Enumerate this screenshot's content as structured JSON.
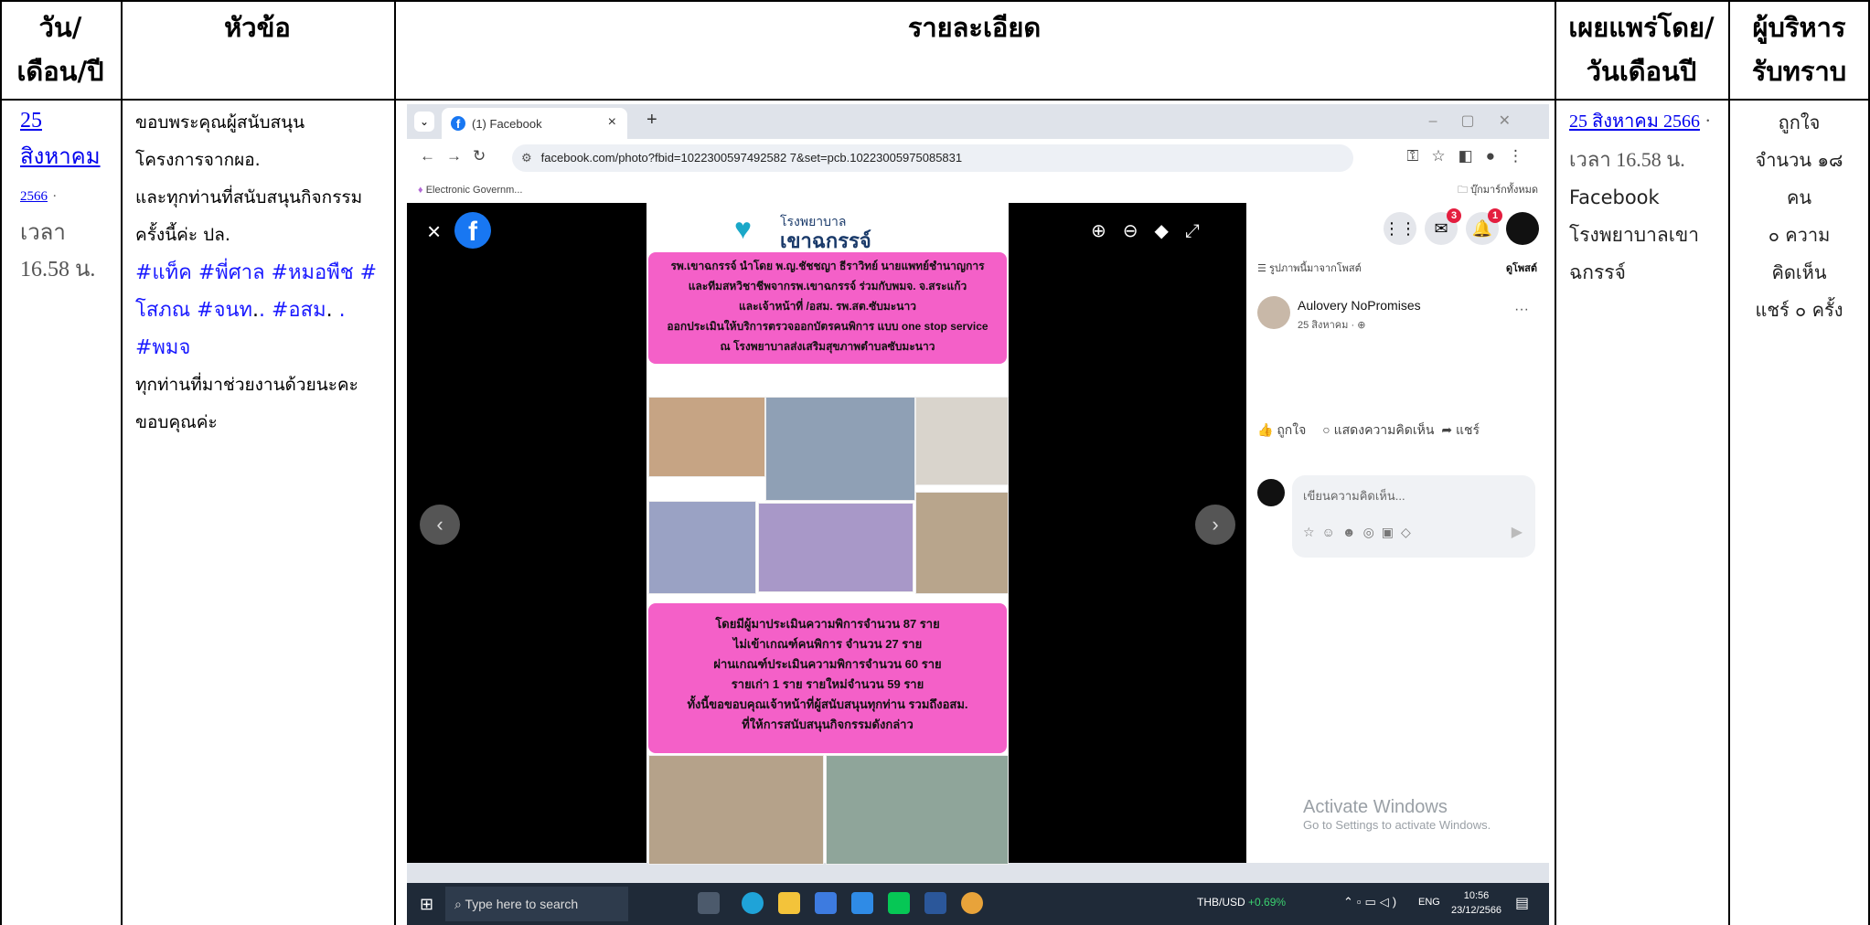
{
  "headers": {
    "date": [
      "วัน/",
      "เดือน/ปี"
    ],
    "topic": "หัวข้อ",
    "details": "รายละเอียด",
    "published": [
      "เผยแพร่โดย/",
      "วันเดือนปี"
    ],
    "admin": [
      "ผู้บริหาร",
      "รับทราบ"
    ]
  },
  "row": {
    "date_link_1": "25 สิงหาคม",
    "date_link_2": "2566",
    "date_dot": "·",
    "time_1": "เวลา",
    "time_2": "16.58 น.",
    "topic_lines": [
      "ขอบพระคุณผู้สนับสนุน",
      "โครงการจากผอ.",
      "และทุกท่านที่สนับสนุนกิจกรรม",
      "ครั้งนี้ค่ะ ปล."
    ],
    "hashtag_line_1": "#แท็ค #พี่ศาล #หมอพืช #",
    "hashtag_line_2_a": "โสภณ #จนท",
    "hashtag_line_2_b": ". #อสม",
    "hashtag_line_2_c": ". #พมจ",
    "hashtag_line_2_d": ".",
    "topic_tail": [
      "ทุกท่านที่มาช่วยงานด้วยนะคะ",
      "ขอบคุณค่ะ"
    ],
    "pub_link": "25 สิงหาคม 2566",
    "pub_dot": "·",
    "pub_time": "เวลา 16.58 น.",
    "pub_source": [
      "Facebook",
      "โรงพยาบาลเขา",
      "ฉกรรจ์"
    ],
    "admin_lines": [
      "ถูกใจ",
      "จำนวน ๑๘",
      "คน",
      "๐ ความ",
      "คิดเห็น",
      "แชร์ ๐ ครั้ง"
    ]
  },
  "screenshot": {
    "tab_title": "(1) Facebook",
    "url": "facebook.com/photo?fbid=1022300597492582 7&set=pcb.10223005975085831",
    "bookmark": "Electronic Governm...",
    "bookmark_folder": "บุ๊กมาร์กทั้งหมด",
    "hospital_small": "โรงพยาบาล",
    "hospital_big": "เขาฉกรรจ์",
    "poster_top": [
      "รพ.เขาฉกรรจ์ นำโดย พ.ญ.ชัชชญา ธีราวิทย์ นายแพทย์ชำนาญการ",
      "และทีมสหวิชาชีพจากรพ.เขาฉกรรจ์ ร่วมกับพมจ. จ.สระแก้ว",
      "และเจ้าหน้าที่ /อสม. รพ.สต.ซับมะนาว",
      "ออกประเมินให้บริการตรวจออกบัตรคนพิการ แบบ one stop service",
      "ณ โรงพยาบาลส่งเสริมสุขภาพตำบลซับมะนาว"
    ],
    "poster_bottom": [
      "โดยมีผู้มาประเมินความพิการจำนวน 87 ราย",
      "ไม่เข้าเกณฑ์คนพิการ จำนวน 27 ราย",
      "ผ่านเกณฑ์ประเมินความพิการจำนวน 60 ราย",
      "รายเก่า 1 ราย รายใหม่จำนวน 59 ราย",
      "ทั้งนี้ขอขอบคุณเจ้าหน้าที่ผู้สนับสนุนทุกท่าน รวมถึงอสม.",
      "ที่ให้การสนับสนุนกิจกรรมดังกล่าว"
    ],
    "panel_header": "รูปภาพนี้มาจากโพสต์",
    "panel_view": "ดูโพสต์",
    "author": "Aulovery NoPromises",
    "author_date": "25 สิงหาคม · ",
    "like": "ถูกใจ",
    "comment": "แสดงความคิดเห็น",
    "share": "แชร์",
    "comment_placeholder": "เขียนความคิดเห็น...",
    "activate_title": "Activate Windows",
    "activate_sub": "Go to Settings to activate Windows.",
    "search_placeholder": "Type here to search",
    "currency": "THB/USD",
    "currency_change": "+0.69%",
    "lang": "ENG",
    "clock_time": "10:56",
    "clock_date": "23/12/2566",
    "badge_messenger": "3",
    "badge_notif": "1"
  }
}
